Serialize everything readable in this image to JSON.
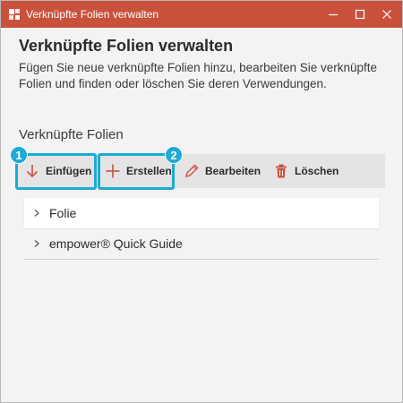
{
  "window": {
    "title": "Verknüpfte Folien verwalten",
    "titlebar_color": "#c9513c",
    "controls": [
      "minimize-icon",
      "maximize-icon",
      "close-icon"
    ]
  },
  "main": {
    "heading": "Verknüpfte Folien verwalten",
    "description": "Fügen Sie neue verknüpfte Folien hinzu, bearbeiten Sie verknüpfte Folien und finden oder löschen Sie deren Verwendungen.",
    "section_title": "Verknüpfte Folien"
  },
  "toolbar": {
    "insert_label": "Einfügen",
    "create_label": "Erstellen",
    "edit_label": "Bearbeiten",
    "delete_label": "Löschen"
  },
  "callouts": {
    "badge_1": "1",
    "badge_2": "2",
    "color": "#1eaad5"
  },
  "list": {
    "items": [
      {
        "label": "Folie"
      },
      {
        "label": "empower® Quick Guide"
      }
    ]
  }
}
